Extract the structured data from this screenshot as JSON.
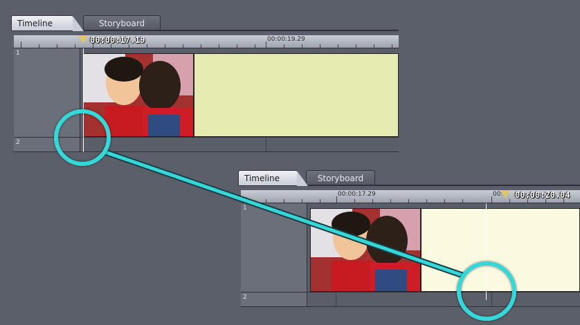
{
  "top_panel": {
    "tabs": [
      {
        "label": "Timeline",
        "active": true
      },
      {
        "label": "Storyboard",
        "active": false
      }
    ],
    "ruler": {
      "timecode": "00:00:17.19",
      "labels": [
        "00:00:19.29"
      ]
    },
    "tracks": [
      "1",
      "2"
    ],
    "clip_fill": "#e6ebb1"
  },
  "bottom_panel": {
    "tabs": [
      {
        "label": "Timeline",
        "active": true
      },
      {
        "label": "Storyboard",
        "active": false
      }
    ],
    "ruler": {
      "timecode": "00:00:20.04",
      "labels": [
        "00:00:17.29",
        "00:"
      ]
    },
    "tracks": [
      "1",
      "2"
    ],
    "clip_fill": "#fbfae0"
  },
  "colors": {
    "background": "#5b5f69",
    "highlight": "#35d7d8",
    "playhead_marker": "#e1c66a"
  },
  "icons": [
    "playhead-marker-icon"
  ]
}
